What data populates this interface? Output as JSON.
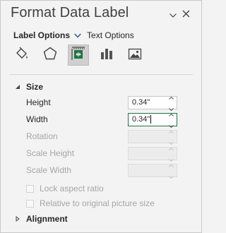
{
  "pane": {
    "title": "Format Data Label",
    "tabs": [
      {
        "label": "Label Options",
        "active": true
      },
      {
        "label": "Text Options",
        "active": false
      }
    ],
    "icons": [
      "fill-line-icon",
      "effects-icon",
      "size-properties-icon",
      "label-options-icon",
      "picture-icon"
    ],
    "active_icon": "size-properties-icon"
  },
  "size_section": {
    "title": "Size",
    "height_label": "Height",
    "height_value": "0.34\"",
    "width_label": "Width",
    "width_value": "0.34\"",
    "rotation_label": "Rotation",
    "rotation_value": "",
    "scale_height_label": "Scale Height",
    "scale_height_value": "",
    "scale_width_label": "Scale Width",
    "scale_width_value": "",
    "lock_aspect_label": "Lock aspect ratio",
    "relative_label": "Relative to original picture size"
  },
  "alignment_section": {
    "title": "Alignment"
  },
  "colors": {
    "accent": "#217346",
    "disabled_text": "#a6a6a6",
    "tab_chevron": "#2b579a"
  }
}
